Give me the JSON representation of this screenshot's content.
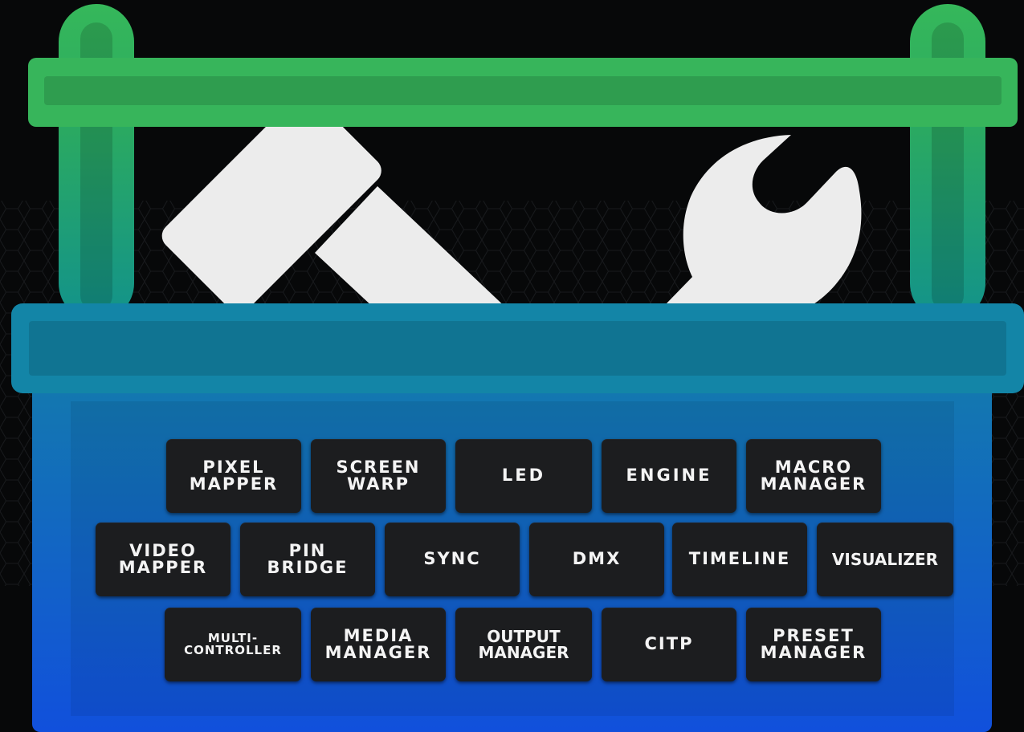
{
  "toolbox": {
    "colors": {
      "background": "#070809",
      "handle_green": "#34b25a",
      "body_blue_top": "#128aa2",
      "body_blue_bottom": "#1152d8",
      "tools": "#ececec",
      "tile_bg": "#1c1d1f",
      "tile_text": "#f4f4f4"
    },
    "icons": [
      "hammer-icon",
      "wrench-icon"
    ],
    "rows": [
      {
        "tiles": [
          {
            "label": "PIXEL\nMAPPER"
          },
          {
            "label": "SCREEN\nWARP"
          },
          {
            "label": "LED"
          },
          {
            "label": "ENGINE"
          },
          {
            "label": "MACRO\nMANAGER"
          }
        ]
      },
      {
        "tiles": [
          {
            "label": "VIDEO\nMAPPER"
          },
          {
            "label": "PIN\nBRIDGE"
          },
          {
            "label": "SYNC"
          },
          {
            "label": "DMX"
          },
          {
            "label": "TIMELINE"
          },
          {
            "label": "VISUALIZER"
          }
        ]
      },
      {
        "tiles": [
          {
            "label": "MULTI-\nCONTROLLER"
          },
          {
            "label": "MEDIA\nMANAGER"
          },
          {
            "label": "OUTPUT\nMANAGER"
          },
          {
            "label": "CITP"
          },
          {
            "label": "PRESET\nMANAGER"
          }
        ]
      }
    ]
  }
}
